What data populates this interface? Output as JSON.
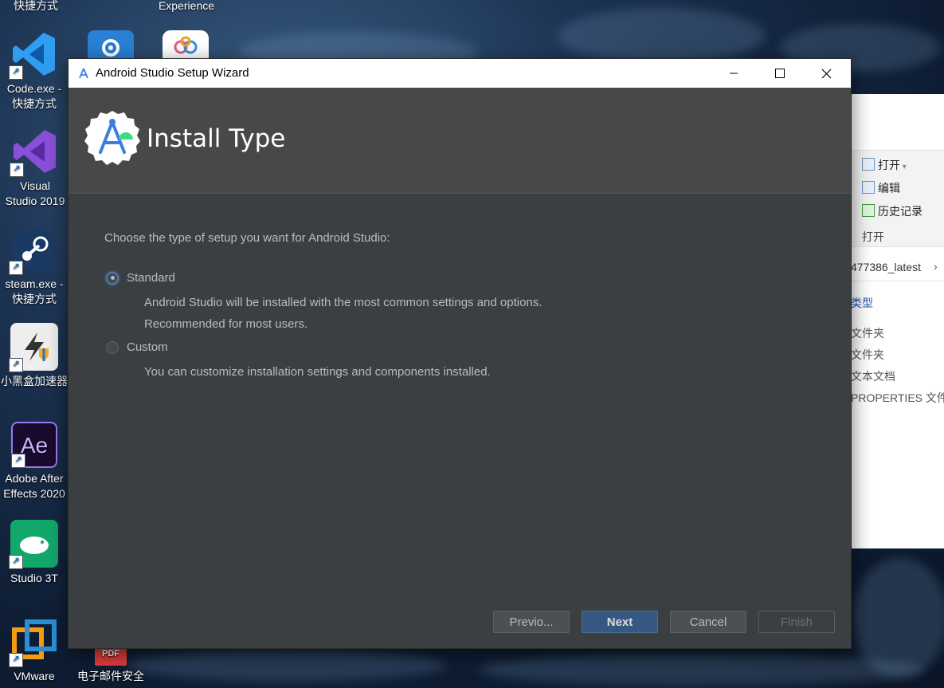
{
  "desktop": {
    "icons": [
      {
        "label": "快捷方式",
        "label2": ""
      },
      {
        "label": "Experience",
        "label2": ""
      },
      {
        "label": "Code.exe -",
        "label2": "快捷方式"
      },
      {
        "label": "Visual",
        "label2": "Studio 2019"
      },
      {
        "label": "steam.exe -",
        "label2": "快捷方式"
      },
      {
        "label": "小黑盒加速器",
        "label2": ""
      },
      {
        "label": "Adobe After",
        "label2": "Effects 2020"
      },
      {
        "label": "Studio 3T",
        "label2": ""
      },
      {
        "label": "VMware",
        "label2": ""
      },
      {
        "label": "电子邮件安全",
        "label2": ""
      }
    ]
  },
  "explorer": {
    "ribbon": {
      "open_dropdown": "打开",
      "edit": "编辑",
      "history": "历史记录",
      "group_label": "打开"
    },
    "address": "477386_latest",
    "column_type": "类型",
    "rows": [
      "文件夹",
      "文件夹",
      "文本文档",
      "PROPERTIES 文件"
    ]
  },
  "dialog": {
    "window_title": "Android Studio Setup Wizard",
    "header_title": "Install Type",
    "prompt": "Choose the type of setup you want for Android Studio:",
    "options": [
      {
        "label": "Standard",
        "checked": true,
        "desc": [
          "Android Studio will be installed with the most common settings and options.",
          "Recommended for most users."
        ]
      },
      {
        "label": "Custom",
        "checked": false,
        "desc": [
          "You can customize installation settings and components installed."
        ]
      }
    ],
    "buttons": {
      "previous": "Previo...",
      "next": "Next",
      "cancel": "Cancel",
      "finish": "Finish"
    },
    "colors": {
      "accent": "#365880",
      "background": "#3c3f41",
      "header": "#464849"
    }
  }
}
